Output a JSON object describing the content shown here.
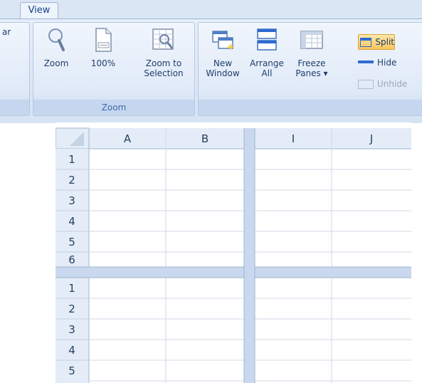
{
  "ribbon": {
    "tab": "View",
    "left_fragment": "ar",
    "zoom_group": {
      "label": "Zoom",
      "buttons": {
        "zoom": "Zoom",
        "hundred": "100%",
        "zoom_selection": "Zoom to\nSelection"
      }
    },
    "window_group": {
      "new_window": "New\nWindow",
      "arrange_all": "Arrange\nAll",
      "freeze_panes": "Freeze\nPanes ▾",
      "split": "Split",
      "hide": "Hide",
      "unhide": "Unhide"
    }
  },
  "sheet": {
    "col_headers_left": [
      "A",
      "B"
    ],
    "col_headers_right": [
      "I",
      "J"
    ],
    "rows_top": [
      "1",
      "2",
      "3",
      "4",
      "5",
      "6"
    ],
    "rows_bottom": [
      "1",
      "2",
      "3",
      "4",
      "5"
    ]
  },
  "colors": {
    "ribbon_bg": "#dbe6f5",
    "header_bg": "#e4ecf7",
    "grid_line": "#d0d7e5",
    "split_bar": "#c9d8ee",
    "split_highlight": "#f8c65c"
  }
}
